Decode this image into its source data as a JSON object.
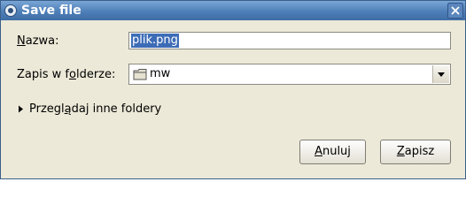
{
  "window": {
    "title": "Save file"
  },
  "form": {
    "name_label_accel": "N",
    "name_label_rest": "azwa:",
    "name_value": "plik.png",
    "folder_label_pre": "Zapis w f",
    "folder_label_accel": "o",
    "folder_label_post": "lderze:",
    "folder_value": "mw"
  },
  "expander": {
    "label_pre": "Przegl",
    "label_accel": "ą",
    "label_post": "daj inne foldery"
  },
  "buttons": {
    "cancel_accel": "A",
    "cancel_rest": "nuluj",
    "save_accel": "Z",
    "save_rest": "apisz"
  }
}
